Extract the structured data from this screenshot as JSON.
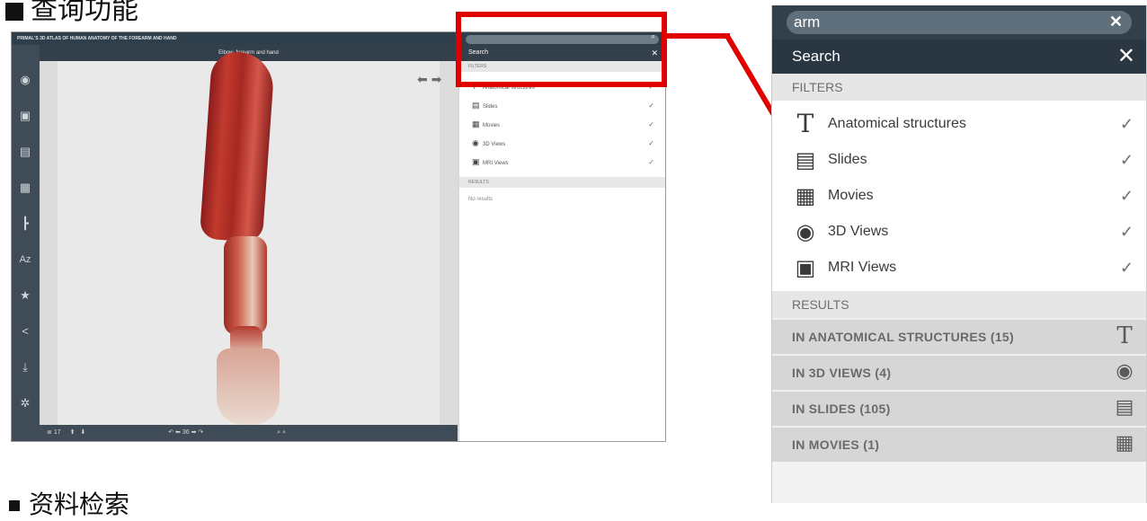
{
  "slide": {
    "heading": "查询功能",
    "bottom_text": "资料检索"
  },
  "app": {
    "title": "PRIMAL'S 3D ATLAS OF HUMAN ANATOMY OF THE FOREARM AND HAND",
    "view_title": "Elbow, forearm and hand",
    "panel": {
      "header": "Search",
      "filters_label": "FILTERS",
      "filters": [
        "Anatomical structures",
        "Slides",
        "Movies",
        "3D Views",
        "MRI Views"
      ],
      "results_label": "RESULTS",
      "no_results": "No results"
    },
    "bottombar": {
      "layer_count": "17",
      "rotation": "36"
    },
    "sidebar_icons": [
      "3d-view-icon",
      "mri-icon",
      "slides-icon",
      "movies-icon",
      "tree-icon",
      "az-index-icon",
      "star-icon",
      "share-icon",
      "download-icon",
      "settings-icon"
    ]
  },
  "panel": {
    "search": {
      "value": "arm",
      "clear_icon": "clear-icon"
    },
    "header": {
      "title": "Search",
      "close_icon": "close-icon"
    },
    "filters_label": "FILTERS",
    "filters": [
      {
        "label": "Anatomical structures",
        "icon": "text-t-icon",
        "checked": true
      },
      {
        "label": "Slides",
        "icon": "slide-icon",
        "checked": true
      },
      {
        "label": "Movies",
        "icon": "movie-camera-icon",
        "checked": true
      },
      {
        "label": "3D Views",
        "icon": "3d-rotate-icon",
        "checked": true
      },
      {
        "label": "MRI Views",
        "icon": "mri-icon",
        "checked": true
      }
    ],
    "results_label": "RESULTS",
    "results": [
      {
        "label": "IN ANATOMICAL STRUCTURES (15)",
        "icon": "text-t-icon"
      },
      {
        "label": "IN 3D VIEWS (4)",
        "icon": "3d-rotate-icon"
      },
      {
        "label": "IN SLIDES (105)",
        "icon": "slide-icon"
      },
      {
        "label": "IN MOVIES (1)",
        "icon": "movie-camera-icon"
      }
    ]
  },
  "colors": {
    "highlight": "#e10000",
    "header_bg": "#2a3641",
    "search_bg": "#333f4a"
  }
}
